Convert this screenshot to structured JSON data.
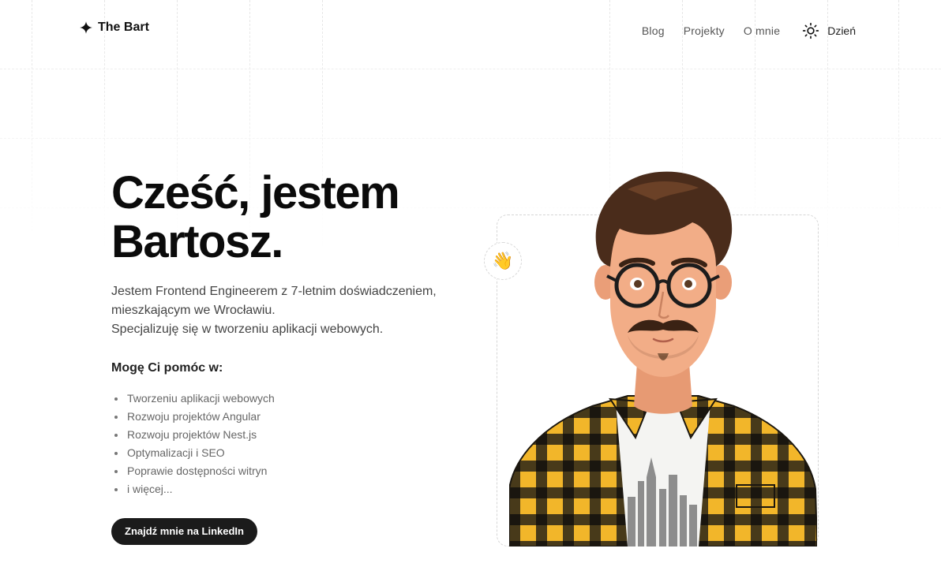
{
  "header": {
    "brand_name": "The Bart",
    "nav": [
      {
        "label": "Blog"
      },
      {
        "label": "Projekty"
      },
      {
        "label": "O mnie"
      }
    ],
    "theme_toggle_label": "Dzień"
  },
  "hero": {
    "title_line1": "Cześć, jestem",
    "title_line2": "Bartosz.",
    "intro_line1": "Jestem Frontend Engineerem z 7-letnim doświadczeniem,",
    "intro_line2": "mieszkającym we Wrocławiu.",
    "intro_line3": "Specjalizuję się w tworzeniu aplikacji webowych.",
    "help_title": "Mogę Ci pomóc w:",
    "help_items": [
      "Tworzeniu aplikacji webowych",
      "Rozwoju projektów Angular",
      "Rozwoju projektów Nest.js",
      "Optymalizacji i SEO",
      "Poprawie dostępności witryn",
      "i więcej..."
    ],
    "cta_label": "Znajdź mnie na LinkedIn"
  },
  "avatar": {
    "wave_emoji": "👋"
  },
  "icons": {
    "brand": "sparkle-icon",
    "theme": "sun-icon",
    "wave": "waving-hand-icon"
  },
  "colors": {
    "text": "#111111",
    "muted": "#555555",
    "cta_bg": "#1b1b1b",
    "shirt_yellow": "#f2b62a",
    "shirt_dark": "#2a2418"
  }
}
